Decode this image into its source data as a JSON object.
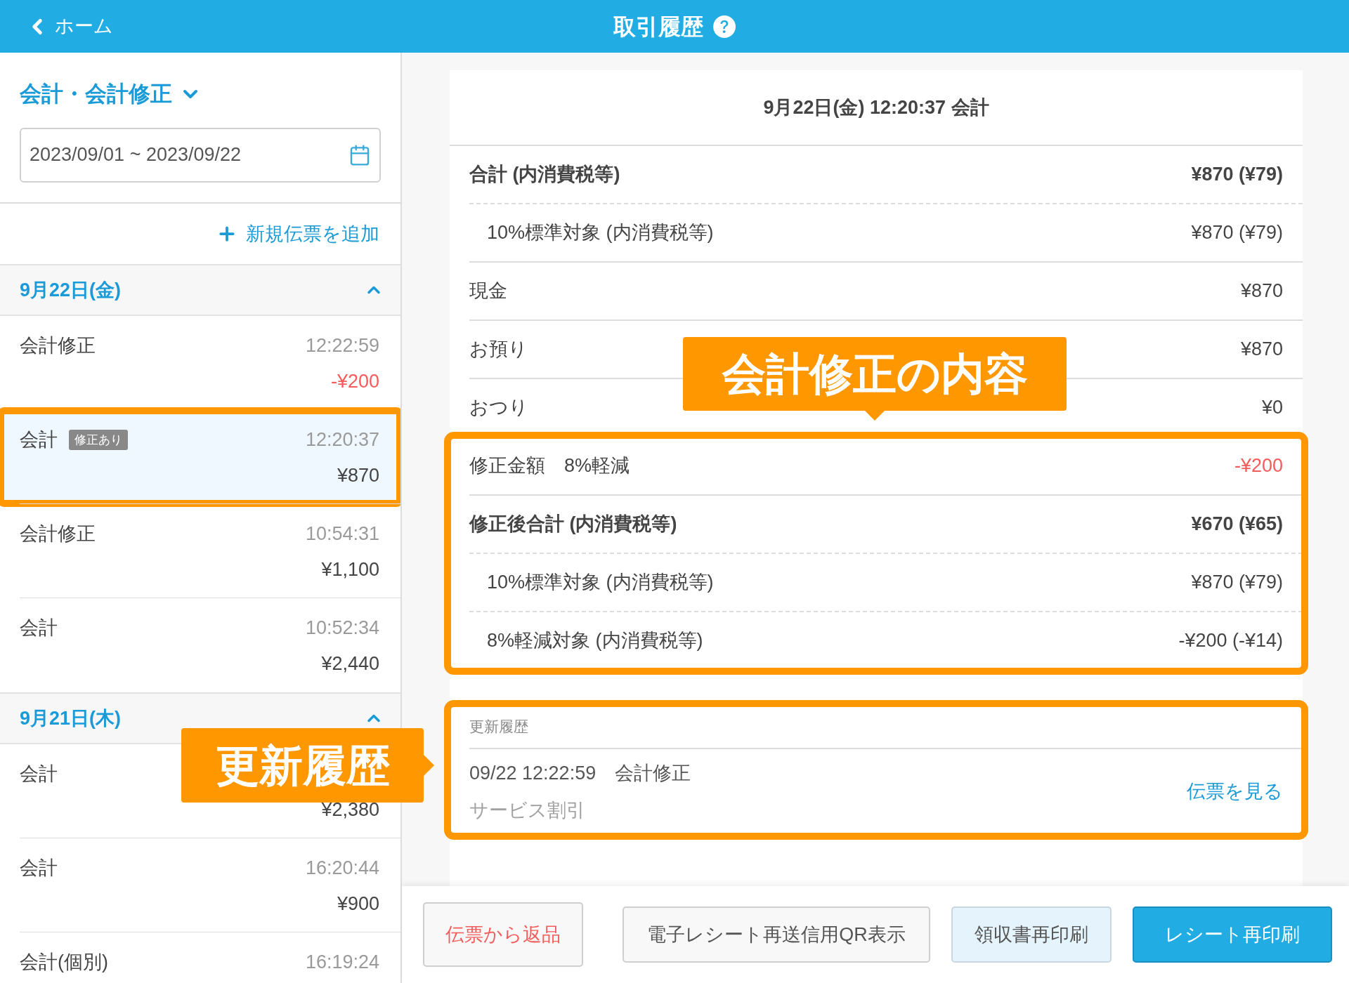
{
  "header": {
    "back_label": "ホーム",
    "title": "取引履歴"
  },
  "sidebar": {
    "filter": "会計・会計修正",
    "date_range": "2023/09/01 ~ 2023/09/22",
    "add_label": "新規伝票を追加",
    "groups": [
      {
        "date": "9月22日(金)",
        "expanded": true,
        "items": [
          {
            "label": "会計修正",
            "time": "12:22:59",
            "amount": "-¥200",
            "negative": true,
            "selected": false,
            "framed": false
          },
          {
            "label": "会計",
            "badge": "修正あり",
            "time": "12:20:37",
            "amount": "¥870",
            "negative": false,
            "selected": true,
            "framed": true
          },
          {
            "label": "会計修正",
            "time": "10:54:31",
            "amount": "¥1,100",
            "negative": false,
            "selected": false,
            "framed": false
          },
          {
            "label": "会計",
            "time": "10:52:34",
            "amount": "¥2,440",
            "negative": false,
            "selected": false,
            "framed": false
          }
        ]
      },
      {
        "date": "9月21日(木)",
        "expanded": true,
        "items": [
          {
            "label": "会計",
            "amount": "¥2,380",
            "negative": false,
            "selected": false,
            "framed": false
          },
          {
            "label": "会計",
            "time": "16:20:44",
            "amount": "¥900",
            "negative": false,
            "selected": false,
            "framed": false
          },
          {
            "label": "会計(個別)",
            "time": "16:19:24",
            "selected": false,
            "framed": false
          }
        ]
      }
    ]
  },
  "detail": {
    "title": "9月22日(金) 12:20:37 会計",
    "sections": [
      {
        "rows": [
          {
            "kind": "total",
            "label": "合計 (内消費税等)",
            "value": "¥870 (¥79)"
          },
          {
            "kind": "sub",
            "label": "10%標準対象 (内消費税等)",
            "value": "¥870 (¥79)"
          },
          {
            "kind": "plain",
            "label": "現金",
            "value": "¥870"
          },
          {
            "kind": "plain",
            "label": "お預り",
            "value": "¥870"
          },
          {
            "kind": "plain",
            "label": "おつり",
            "value": "¥0"
          }
        ]
      },
      {
        "framed": true,
        "rows": [
          {
            "kind": "negative",
            "label": "修正金額　8%軽減",
            "value": "-¥200"
          },
          {
            "kind": "total",
            "label": "修正後合計 (内消費税等)",
            "value": "¥670 (¥65)"
          },
          {
            "kind": "sub",
            "label": "10%標準対象 (内消費税等)",
            "value": "¥870 (¥79)"
          },
          {
            "kind": "sub",
            "label": "8%軽減対象 (内消費税等)",
            "value": "-¥200 (-¥14)"
          }
        ]
      }
    ],
    "history": {
      "framed": true,
      "heading": "更新履歴",
      "entries": [
        {
          "datetime": "09/22 12:22:59　会計修正",
          "note": "サービス割引",
          "link": "伝票を見る"
        }
      ]
    }
  },
  "actions": [
    {
      "kind": "danger",
      "label": "伝票から返品"
    },
    {
      "kind": "default",
      "label": "電子レシート再送信用QR表示"
    },
    {
      "kind": "light",
      "label": "領収書再印刷"
    },
    {
      "kind": "primary",
      "label": "レシート再印刷"
    }
  ],
  "callouts": [
    {
      "text": "会計修正の内容",
      "kind": "down"
    },
    {
      "text": "更新履歴",
      "kind": "right"
    }
  ]
}
